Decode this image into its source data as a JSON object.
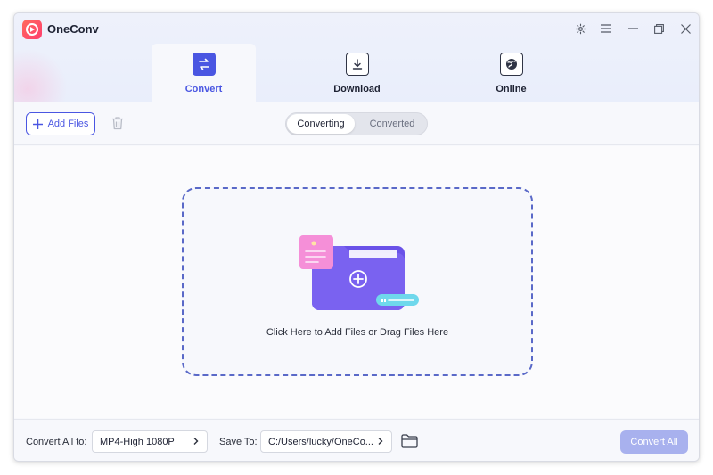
{
  "app": {
    "title": "OneConv"
  },
  "tabs": [
    {
      "label": "Convert",
      "icon": "convert-icon",
      "active": true
    },
    {
      "label": "Download",
      "icon": "download-icon",
      "active": false
    },
    {
      "label": "Online",
      "icon": "online-icon",
      "active": false
    }
  ],
  "toolbar": {
    "add_files_label": "Add Files",
    "segments": [
      {
        "label": "Converting",
        "active": true
      },
      {
        "label": "Converted",
        "active": false
      }
    ]
  },
  "dropzone": {
    "text": "Click Here to Add Files or Drag Files Here"
  },
  "bottom": {
    "convert_all_to_label": "Convert All to:",
    "format_value": "MP4-High 1080P",
    "save_to_label": "Save To:",
    "save_path": "C:/Users/lucky/OneCo...",
    "convert_all_label": "Convert All"
  },
  "colors": {
    "accent": "#4a56e2",
    "convert_all_disabled": "#a8b1ee",
    "folder_purple": "#7a62f0",
    "note_pink": "#f58fd8"
  }
}
